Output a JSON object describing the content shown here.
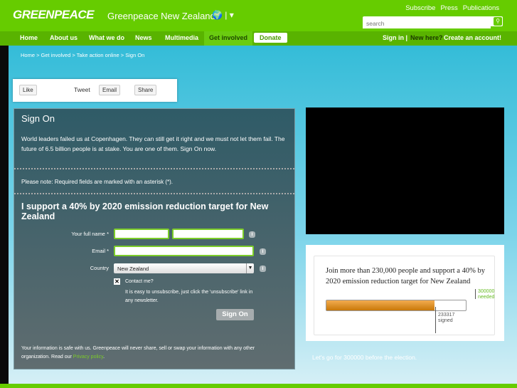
{
  "header": {
    "logo": "GREENPEACE",
    "site": "Greenpeace New Zealand",
    "globe": "🌍 | ▾",
    "links": [
      "Subscribe",
      "Press",
      "Publications"
    ],
    "search_placeholder": "search"
  },
  "nav": {
    "items": [
      "Home",
      "About us",
      "What we do",
      "News",
      "Multimedia",
      "Get involved"
    ],
    "donate": "Donate",
    "signin": "Sign in |",
    "newhere": "New here?",
    "create": "Create an account!"
  },
  "breadcrumb": "Home > Get involved > Take action online > Sign On",
  "share": {
    "like": "Like",
    "tweet": "Tweet",
    "email": "Email",
    "share": "Share"
  },
  "panel": {
    "title": "Sign On",
    "intro": "World leaders failed us at Copenhagen. They can still get it right and we must not let them fail. The future of 6.5 billion people is at stake. You are one of them. Sign On now.",
    "note": "Please note: Required fields are marked with an asterisk (*).",
    "heading": "I support a 40% by 2020 emission reduction target for New Zealand",
    "name_label": "Your full name *",
    "email_label": "Email *",
    "country_label": "Country",
    "country_value": "New Zealand",
    "contact_label": "Contact me?",
    "unsub": "It is easy to unsubscribe, just click the 'unsubscribe' link in any newsletter.",
    "submit": "Sign On",
    "privacy_text": "Your information is safe with us. Greenpeace will never share, sell or swap your information with any other organization. Read our ",
    "privacy_link": "Privacy policy",
    "privacy_end": "."
  },
  "progress": {
    "text": "Join more than 230,000 people and support a 40% by 2020 emission reduction target for New Zealand",
    "signed": "233317",
    "signed_label": "signed",
    "needed": "300000",
    "needed_label": "needed",
    "fraction": 0.778
  },
  "footer_note": "Let's go for 300000 before the election."
}
